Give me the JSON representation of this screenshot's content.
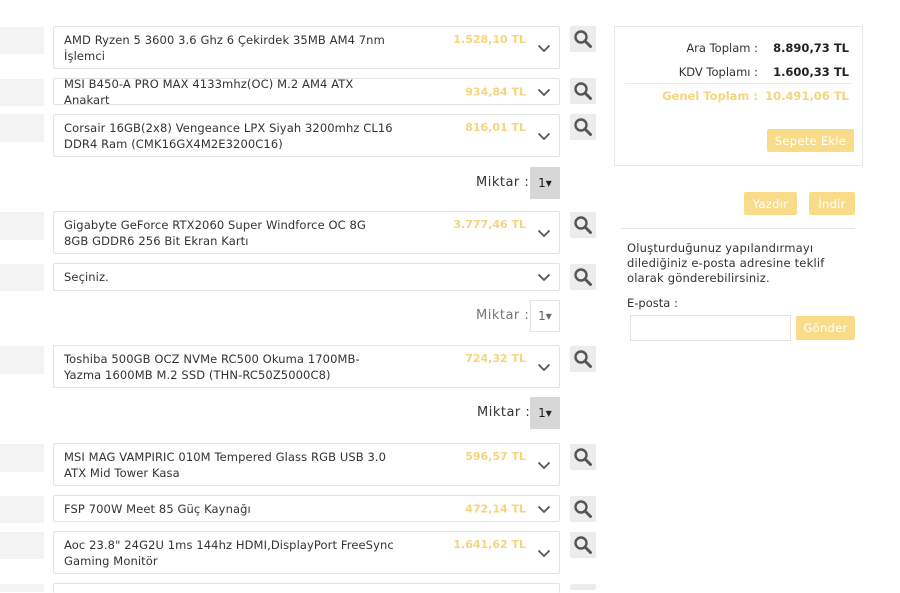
{
  "components": [
    {
      "name": "AMD Ryzen 5 3600 3.6 Ghz 6 Çekirdek 35MB AM4 7nm İşlemci",
      "price": "1.528,10 TL"
    },
    {
      "name": "MSI B450-A PRO MAX 4133mhz(OC) M.2 AM4 ATX Anakart",
      "price": "934,84 TL"
    },
    {
      "name": "Corsair 16GB(2x8) Vengeance LPX Siyah 3200mhz CL16 DDR4 Ram (CMK16GX4M2E3200C16)",
      "price": "816,01 TL"
    },
    {
      "name": "Gigabyte GeForce RTX2060 Super Windforce OC 8G 8GB GDDR6 256 Bit Ekran Kartı",
      "price": "3.777,46 TL"
    },
    {
      "name": "Seçiniz.",
      "price": ""
    },
    {
      "name": "Toshiba 500GB OCZ NVMe RC500 Okuma 1700MB-Yazma 1600MB M.2 SSD (THN-RC50Z5000C8)",
      "price": "724,32 TL"
    },
    {
      "name": "MSI MAG VAMPIRIC 010M Tempered Glass RGB USB 3.0 ATX Mid Tower Kasa",
      "price": "596,57 TL"
    },
    {
      "name": "FSP 700W Meet 85 Güç Kaynağı",
      "price": "472,14 TL"
    },
    {
      "name": "Aoc 23.8\" 24G2U 1ms 144hz HDMI,DisplayPort FreeSync Gaming Monitör",
      "price": "1.641,62 TL"
    }
  ],
  "quantity": {
    "label": "Miktar :",
    "ram_value": "1▾",
    "gpu_value": "1▾",
    "ssd_value": "1▾"
  },
  "summary": {
    "subtotal_label": "Ara Toplam :",
    "subtotal_value": "8.890,73 TL",
    "vat_label": "KDV Toplamı :",
    "vat_value": "1.600,33 TL",
    "total_label": "Genel Toplam :",
    "total_value": "10.491,06 TL",
    "add_to_cart": "Sepete Ekle"
  },
  "actions": {
    "print": "Yazdır",
    "download": "İndir"
  },
  "email": {
    "info": "Oluşturduğunuz yapılandırmayı dilediğiniz e-posta adresine teklif olarak gönderebilirsiniz.",
    "label": "E-posta :",
    "value": "",
    "send": "Gönder"
  },
  "icons": {
    "search": "search-icon",
    "dropdown": "chevron-down-icon"
  },
  "colors": {
    "accent": "#f8dc8a",
    "price": "#f4d57e"
  }
}
